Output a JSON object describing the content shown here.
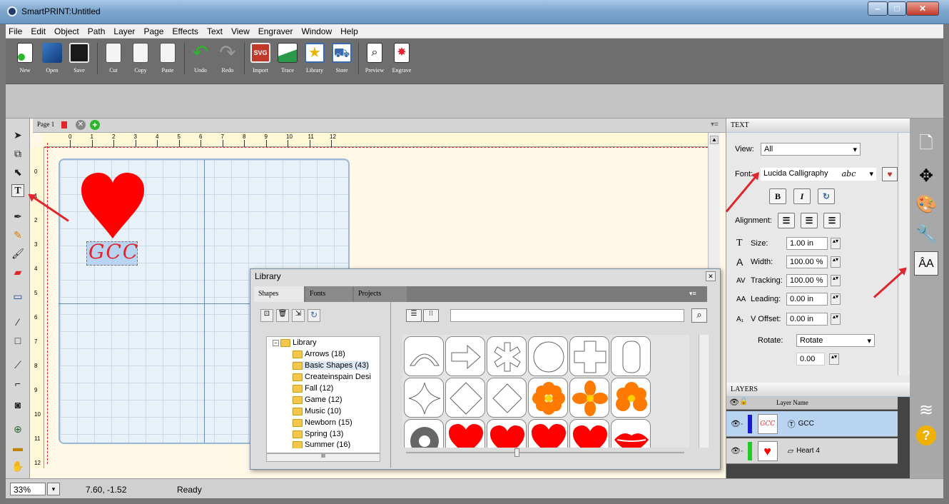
{
  "window": {
    "title": "SmartPRINT:Untitled"
  },
  "menu": [
    "File",
    "Edit",
    "Object",
    "Path",
    "Layer",
    "Page",
    "Effects",
    "Text",
    "View",
    "Engraver",
    "Window",
    "Help"
  ],
  "toolbar": [
    "New",
    "Open",
    "Save",
    "Cut",
    "Copy",
    "Paste",
    "Undo",
    "Redo",
    "Import",
    "Trace",
    "Library",
    "Store",
    "Preview",
    "Engrave"
  ],
  "import_badge": "SVG",
  "page_tab": {
    "label": "Page 1"
  },
  "ruler_labels": [
    "0",
    "1",
    "2",
    "3",
    "4",
    "5",
    "6",
    "7",
    "8",
    "9",
    "10",
    "11",
    "12"
  ],
  "vruler_labels": [
    "0",
    "1",
    "2",
    "3",
    "4",
    "5",
    "6",
    "7",
    "8",
    "9",
    "10",
    "11",
    "12"
  ],
  "canvas": {
    "text": "GCC"
  },
  "text_panel": {
    "header": "TEXT",
    "view_label": "View:",
    "view_value": "All",
    "font_label": "Font:",
    "font_value": "Lucida Calligraphy",
    "font_preview": "abc",
    "bold": "B",
    "italic": "I",
    "alignment_label": "Alignment:",
    "size_label": "Size:",
    "size_value": "1.00 in",
    "width_label": "Width:",
    "width_value": "100.00 %",
    "tracking_label": "Tracking:",
    "tracking_value": "100.00 %",
    "leading_label": "Leading:",
    "leading_value": "0.00 in",
    "voffset_label": "V Offset:",
    "voffset_value": "0.00 in",
    "rotate_label": "Rotate:",
    "rotate_value": "Rotate",
    "rotate_amount": "0.00"
  },
  "layers_panel": {
    "header": "LAYERS",
    "col_name": "Layer Name",
    "layers": [
      {
        "name": "GCC",
        "color": "#1a1acc"
      },
      {
        "name": "Heart 4",
        "color": "#22cc22"
      }
    ]
  },
  "library": {
    "title": "Library",
    "tabs": [
      "Shapes",
      "Fonts",
      "Projects"
    ],
    "tree_root": "Library",
    "tree": [
      "Arrows (18)",
      "Basic Shapes (43)",
      "Createinspain Desi",
      "Fall (12)",
      "Game (12)",
      "Music (10)",
      "Newborn (15)",
      "Spring (13)",
      "Summer (16)"
    ],
    "scroll_marker": "III"
  },
  "status": {
    "zoom": "33%",
    "coords": "7.60, -1.52",
    "message": "Ready"
  },
  "colors": {
    "accent": "#e0252c",
    "heart": "#ff0000",
    "flower": "#ff7a00",
    "selection": "#b8d4f0"
  }
}
